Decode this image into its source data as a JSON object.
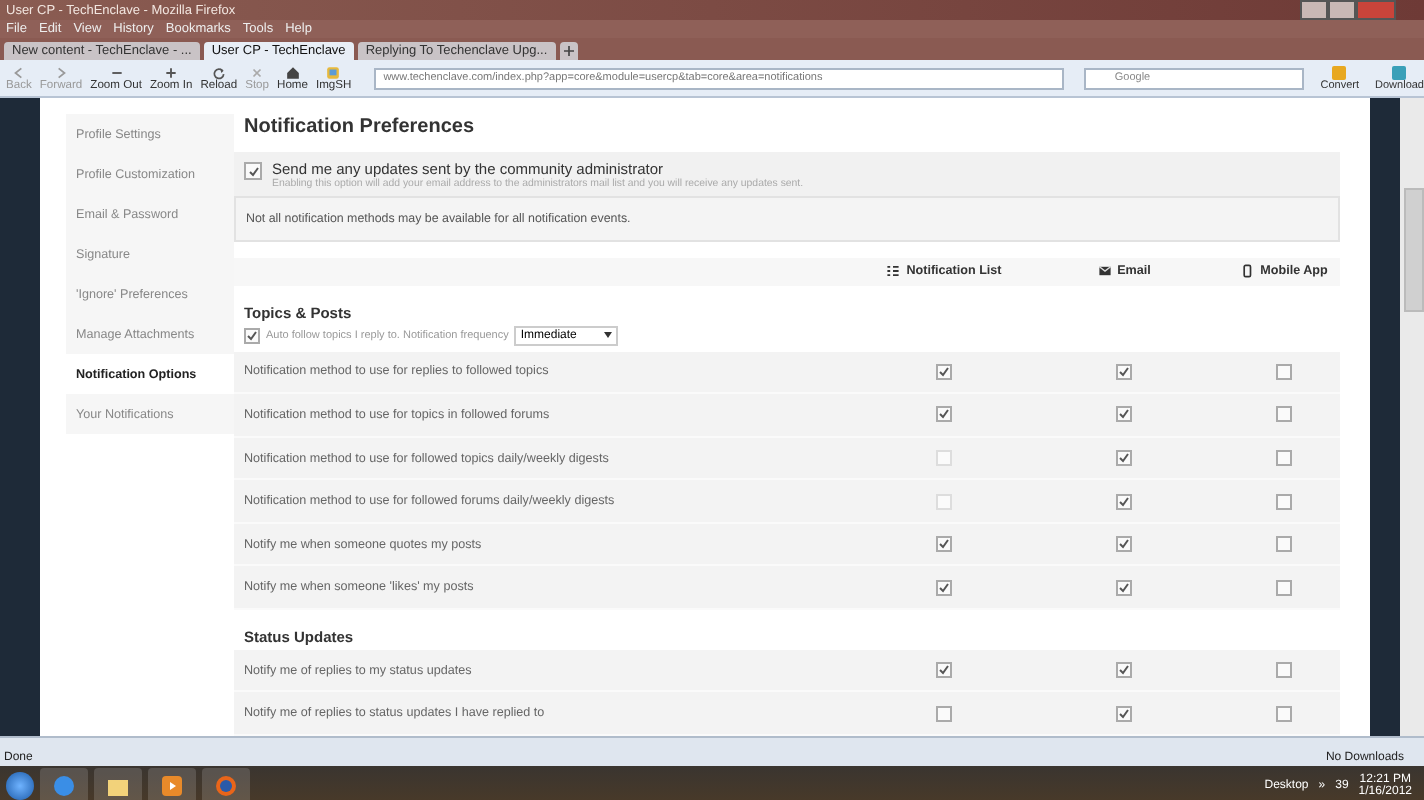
{
  "window": {
    "title": "User CP - TechEnclave - Mozilla Firefox"
  },
  "menu": [
    "File",
    "Edit",
    "View",
    "History",
    "Bookmarks",
    "Tools",
    "Help"
  ],
  "tabs": [
    {
      "label": "New content - TechEnclave - ...",
      "selected": false
    },
    {
      "label": "User CP - TechEnclave",
      "selected": true
    },
    {
      "label": "Replying To Techenclave Upg...",
      "selected": false
    }
  ],
  "toolbar": [
    {
      "label": "Back",
      "kind": "back",
      "disabled": true
    },
    {
      "label": "Forward",
      "kind": "forward",
      "disabled": true
    },
    {
      "label": "Zoom Out",
      "kind": "minus",
      "disabled": false
    },
    {
      "label": "Zoom In",
      "kind": "plus",
      "disabled": false
    },
    {
      "label": "Reload",
      "kind": "reload",
      "disabled": false
    },
    {
      "label": "Stop",
      "kind": "stop",
      "disabled": true
    },
    {
      "label": "Home",
      "kind": "home",
      "disabled": false
    },
    {
      "label": "ImgSH",
      "kind": "img",
      "disabled": false
    }
  ],
  "address": {
    "value": "www.techenclave.com/index.php?app=core&module=usercp&tab=core&area=notifications"
  },
  "search": {
    "placeholder": "Google"
  },
  "extras": [
    "Convert",
    "Download"
  ],
  "sidebar": [
    {
      "label": "Profile Settings",
      "selected": false
    },
    {
      "label": "Profile Customization",
      "selected": false
    },
    {
      "label": "Email & Password",
      "selected": false
    },
    {
      "label": "Signature",
      "selected": false
    },
    {
      "label": "'Ignore' Preferences",
      "selected": false
    },
    {
      "label": "Manage Attachments",
      "selected": false
    },
    {
      "label": "Notification Options",
      "selected": true
    },
    {
      "label": "Your Notifications",
      "selected": false
    }
  ],
  "heading": "Notification Preferences",
  "admin_option": {
    "label": "Send me any updates sent by the community administrator",
    "checked": true,
    "hint": "Enabling this option will add your email address to the administrators mail list and you will receive any updates sent."
  },
  "note": "Not all notification methods may be available for all notification events.",
  "columns": [
    {
      "label": "Notification List",
      "kind": "list"
    },
    {
      "label": "Email",
      "kind": "mail"
    },
    {
      "label": "Mobile App",
      "kind": "phone"
    }
  ],
  "sections": [
    {
      "title": "Topics & Posts",
      "auto_follow": {
        "label": "Auto follow topics I reply to. Notification frequency",
        "checked": true,
        "frequency": "Immediate"
      },
      "rows": [
        {
          "label": "Notification method to use for replies to followed topics",
          "options": [
            {
              "checked": true,
              "disabled": false
            },
            {
              "checked": true,
              "disabled": false
            },
            {
              "checked": false,
              "disabled": false
            }
          ]
        },
        {
          "label": "Notification method to use for topics in followed forums",
          "options": [
            {
              "checked": true,
              "disabled": false
            },
            {
              "checked": true,
              "disabled": false
            },
            {
              "checked": false,
              "disabled": false
            }
          ]
        },
        {
          "label": "Notification method to use for followed topics daily/weekly digests",
          "options": [
            {
              "checked": false,
              "disabled": true
            },
            {
              "checked": true,
              "disabled": false
            },
            {
              "checked": false,
              "disabled": false
            }
          ]
        },
        {
          "label": "Notification method to use for followed forums daily/weekly digests",
          "options": [
            {
              "checked": false,
              "disabled": true
            },
            {
              "checked": true,
              "disabled": false
            },
            {
              "checked": false,
              "disabled": false
            }
          ]
        },
        {
          "label": "Notify me when someone quotes my posts",
          "options": [
            {
              "checked": true,
              "disabled": false
            },
            {
              "checked": true,
              "disabled": false
            },
            {
              "checked": false,
              "disabled": false
            }
          ]
        },
        {
          "label": "Notify me when someone 'likes' my posts",
          "options": [
            {
              "checked": true,
              "disabled": false
            },
            {
              "checked": true,
              "disabled": false
            },
            {
              "checked": false,
              "disabled": false
            }
          ]
        }
      ]
    },
    {
      "title": "Status Updates",
      "rows": [
        {
          "label": "Notify me of replies to my status updates",
          "options": [
            {
              "checked": true,
              "disabled": false
            },
            {
              "checked": true,
              "disabled": false
            },
            {
              "checked": false,
              "disabled": false
            }
          ]
        },
        {
          "label": "Notify me of replies to status updates I have replied to",
          "options": [
            {
              "checked": false,
              "disabled": false
            },
            {
              "checked": true,
              "disabled": false
            },
            {
              "checked": false,
              "disabled": false
            }
          ]
        }
      ]
    }
  ],
  "status_bar": {
    "text": "Done",
    "downloads": "No Downloads"
  },
  "taskbar": {
    "toolbar": "Desktop",
    "chevron": "»",
    "tray_number": "39",
    "time": "12:21 PM",
    "date": "1/16/2012"
  }
}
